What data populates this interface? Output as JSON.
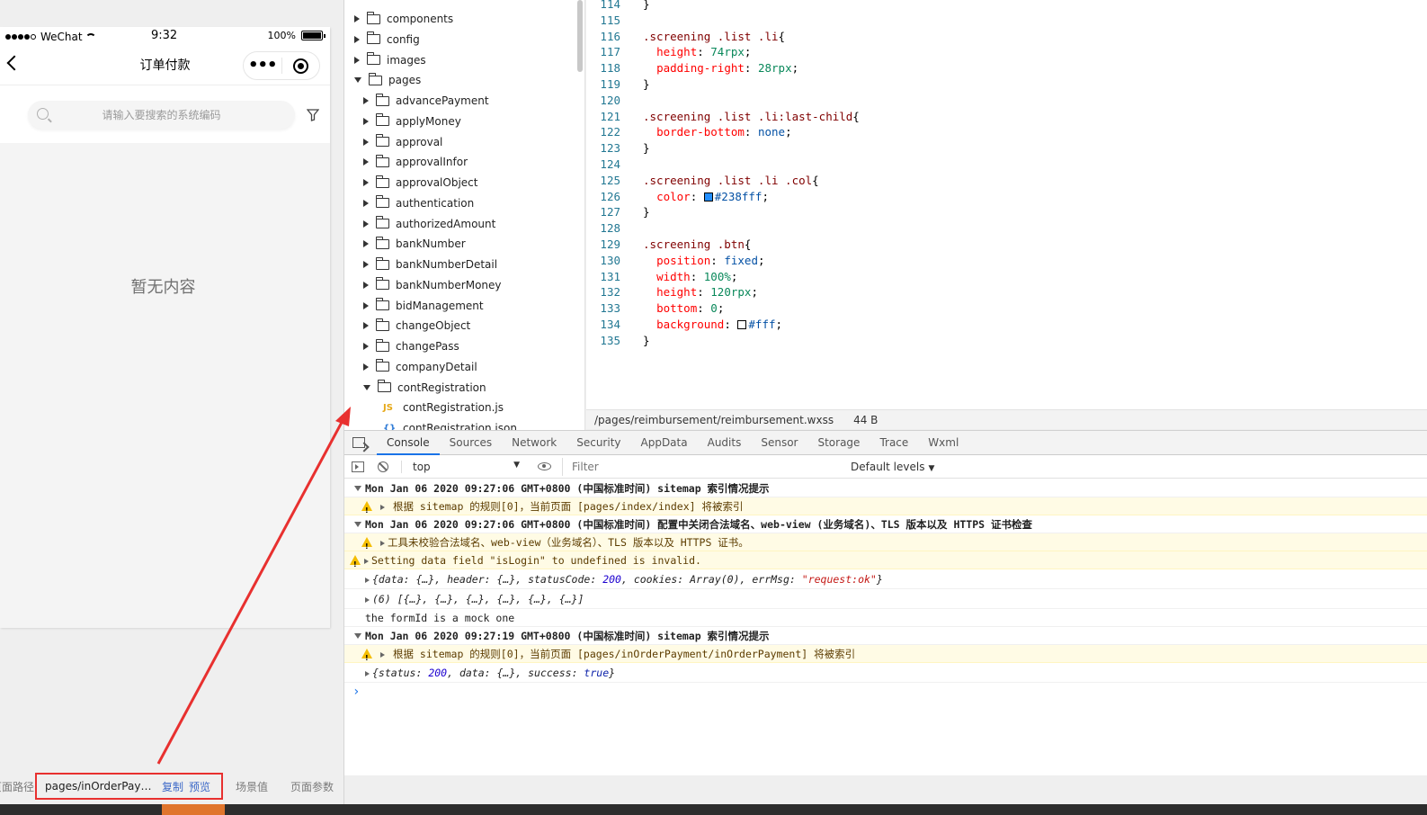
{
  "simulator": {
    "status": {
      "carrier": "WeChat",
      "time": "9:32",
      "battery": "100%"
    },
    "nav_title": "订单付款",
    "search_placeholder": "请输入要搜索的系统编码",
    "empty_text": "暂无内容",
    "footer": {
      "path_label": "页面路径",
      "path": "pages/inOrderPayment/inOrderPayment",
      "copy": "复制",
      "preview": "预览",
      "scene": "场景值",
      "params": "页面参数"
    }
  },
  "tree": {
    "items": [
      {
        "label": "components",
        "kind": "folder",
        "open": false,
        "depth": 0
      },
      {
        "label": "config",
        "kind": "folder",
        "open": false,
        "depth": 0
      },
      {
        "label": "images",
        "kind": "folder",
        "open": false,
        "depth": 0
      },
      {
        "label": "pages",
        "kind": "folder",
        "open": true,
        "depth": 0
      },
      {
        "label": "advancePayment",
        "kind": "folder",
        "open": false,
        "depth": 1
      },
      {
        "label": "applyMoney",
        "kind": "folder",
        "open": false,
        "depth": 1
      },
      {
        "label": "approval",
        "kind": "folder",
        "open": false,
        "depth": 1
      },
      {
        "label": "approvalInfor",
        "kind": "folder",
        "open": false,
        "depth": 1
      },
      {
        "label": "approvalObject",
        "kind": "folder",
        "open": false,
        "depth": 1
      },
      {
        "label": "authentication",
        "kind": "folder",
        "open": false,
        "depth": 1
      },
      {
        "label": "authorizedAmount",
        "kind": "folder",
        "open": false,
        "depth": 1
      },
      {
        "label": "bankNumber",
        "kind": "folder",
        "open": false,
        "depth": 1
      },
      {
        "label": "bankNumberDetail",
        "kind": "folder",
        "open": false,
        "depth": 1
      },
      {
        "label": "bankNumberMoney",
        "kind": "folder",
        "open": false,
        "depth": 1
      },
      {
        "label": "bidManagement",
        "kind": "folder",
        "open": false,
        "depth": 1
      },
      {
        "label": "changeObject",
        "kind": "folder",
        "open": false,
        "depth": 1
      },
      {
        "label": "changePass",
        "kind": "folder",
        "open": false,
        "depth": 1
      },
      {
        "label": "companyDetail",
        "kind": "folder",
        "open": false,
        "depth": 1
      },
      {
        "label": "contRegistration",
        "kind": "folder",
        "open": true,
        "depth": 1
      },
      {
        "label": "contRegistration.js",
        "kind": "js",
        "icon": "JS",
        "depth": 2
      },
      {
        "label": "contRegistration.json",
        "kind": "json",
        "icon": "{}",
        "depth": 2
      }
    ]
  },
  "editor": {
    "lines": [
      {
        "n": "114",
        "tokens": [
          [
            "punc",
            "}"
          ]
        ]
      },
      {
        "n": "115",
        "tokens": []
      },
      {
        "n": "116",
        "tokens": [
          [
            "sel",
            ".screening .list .li"
          ],
          [
            "punc",
            "{"
          ]
        ]
      },
      {
        "n": "117",
        "tokens": [
          [
            "punc",
            "  "
          ],
          [
            "prop",
            "height"
          ],
          [
            "punc",
            ": "
          ],
          [
            "val-num",
            "74rpx"
          ],
          [
            "punc",
            ";"
          ]
        ]
      },
      {
        "n": "118",
        "tokens": [
          [
            "punc",
            "  "
          ],
          [
            "prop",
            "padding-right"
          ],
          [
            "punc",
            ": "
          ],
          [
            "val-num",
            "28rpx"
          ],
          [
            "punc",
            ";"
          ]
        ]
      },
      {
        "n": "119",
        "tokens": [
          [
            "punc",
            "}"
          ]
        ]
      },
      {
        "n": "120",
        "tokens": []
      },
      {
        "n": "121",
        "tokens": [
          [
            "sel",
            ".screening .list .li:last-child"
          ],
          [
            "punc",
            "{"
          ]
        ]
      },
      {
        "n": "122",
        "tokens": [
          [
            "punc",
            "  "
          ],
          [
            "prop",
            "border-bottom"
          ],
          [
            "punc",
            ": "
          ],
          [
            "val-kw",
            "none"
          ],
          [
            "punc",
            ";"
          ]
        ]
      },
      {
        "n": "123",
        "tokens": [
          [
            "punc",
            "}"
          ]
        ]
      },
      {
        "n": "124",
        "tokens": []
      },
      {
        "n": "125",
        "tokens": [
          [
            "sel",
            ".screening .list .li .col"
          ],
          [
            "punc",
            "{"
          ]
        ]
      },
      {
        "n": "126",
        "tokens": [
          [
            "punc",
            "  "
          ],
          [
            "prop",
            "color"
          ],
          [
            "punc",
            ": "
          ],
          [
            "swatch",
            "#238fff"
          ],
          [
            "val-kw",
            "#238fff"
          ],
          [
            "punc",
            ";"
          ]
        ]
      },
      {
        "n": "127",
        "tokens": [
          [
            "punc",
            "}"
          ]
        ]
      },
      {
        "n": "128",
        "tokens": []
      },
      {
        "n": "129",
        "tokens": [
          [
            "sel",
            ".screening .btn"
          ],
          [
            "punc",
            "{"
          ]
        ]
      },
      {
        "n": "130",
        "tokens": [
          [
            "punc",
            "  "
          ],
          [
            "prop",
            "position"
          ],
          [
            "punc",
            ": "
          ],
          [
            "val-kw",
            "fixed"
          ],
          [
            "punc",
            ";"
          ]
        ]
      },
      {
        "n": "131",
        "tokens": [
          [
            "punc",
            "  "
          ],
          [
            "prop",
            "width"
          ],
          [
            "punc",
            ": "
          ],
          [
            "val-num",
            "100%"
          ],
          [
            "punc",
            ";"
          ]
        ]
      },
      {
        "n": "132",
        "tokens": [
          [
            "punc",
            "  "
          ],
          [
            "prop",
            "height"
          ],
          [
            "punc",
            ": "
          ],
          [
            "val-num",
            "120rpx"
          ],
          [
            "punc",
            ";"
          ]
        ]
      },
      {
        "n": "133",
        "tokens": [
          [
            "punc",
            "  "
          ],
          [
            "prop",
            "bottom"
          ],
          [
            "punc",
            ": "
          ],
          [
            "val-num",
            "0"
          ],
          [
            "punc",
            ";"
          ]
        ]
      },
      {
        "n": "134",
        "tokens": [
          [
            "punc",
            "  "
          ],
          [
            "prop",
            "background"
          ],
          [
            "punc",
            ": "
          ],
          [
            "swatch",
            "#ffffff"
          ],
          [
            "val-kw",
            "#fff"
          ],
          [
            "punc",
            ";"
          ]
        ]
      },
      {
        "n": "135",
        "tokens": [
          [
            "punc",
            "}"
          ]
        ]
      }
    ],
    "status_path": "/pages/reimbursement/reimbursement.wxss",
    "status_size": "44 B"
  },
  "devtools": {
    "tabs": [
      "Console",
      "Sources",
      "Network",
      "Security",
      "AppData",
      "Audits",
      "Sensor",
      "Storage",
      "Trace",
      "Wxml"
    ],
    "active_tab": "Console",
    "context": "top",
    "filter_placeholder": "Filter",
    "levels": "Default levels",
    "console": [
      {
        "type": "group",
        "text": "Mon Jan 06 2020 09:27:06 GMT+0800 (中国标准时间) sitemap 索引情况提示"
      },
      {
        "type": "warn-nested",
        "text": "根据 sitemap 的规则[0]，当前页面 [pages/index/index] 将被索引"
      },
      {
        "type": "group",
        "text": "Mon Jan 06 2020 09:27:06 GMT+0800 (中国标准时间) 配置中关闭合法域名、web-view (业务域名)、TLS 版本以及 HTTPS 证书检查"
      },
      {
        "type": "warn-nested-tight",
        "text": "工具未校验合法域名、web-view（业务域名）、TLS 版本以及 HTTPS 证书。"
      },
      {
        "type": "warn",
        "text": "Setting data field \"isLogin\" to undefined is invalid."
      },
      {
        "type": "obj1",
        "text": "{data: {…}, header: {…}, statusCode: 200, cookies: Array(0), errMsg: \"request:ok\"}"
      },
      {
        "type": "obj2",
        "text": "(6) [{…}, {…}, {…}, {…}, {…}, {…}]"
      },
      {
        "type": "log",
        "text": "the formId is a mock one"
      },
      {
        "type": "group",
        "text": "Mon Jan 06 2020 09:27:19 GMT+0800 (中国标准时间) sitemap 索引情况提示"
      },
      {
        "type": "warn-nested",
        "text": "根据 sitemap 的规则[0]，当前页面 [pages/inOrderPayment/inOrderPayment] 将被索引"
      },
      {
        "type": "obj3",
        "text": "{status: 200, data: {…}, success: true}"
      }
    ]
  },
  "colors": {
    "annotation_red": "#e8302f",
    "accent_blue": "#1a73e8",
    "warn_bg": "#fffbe5"
  }
}
